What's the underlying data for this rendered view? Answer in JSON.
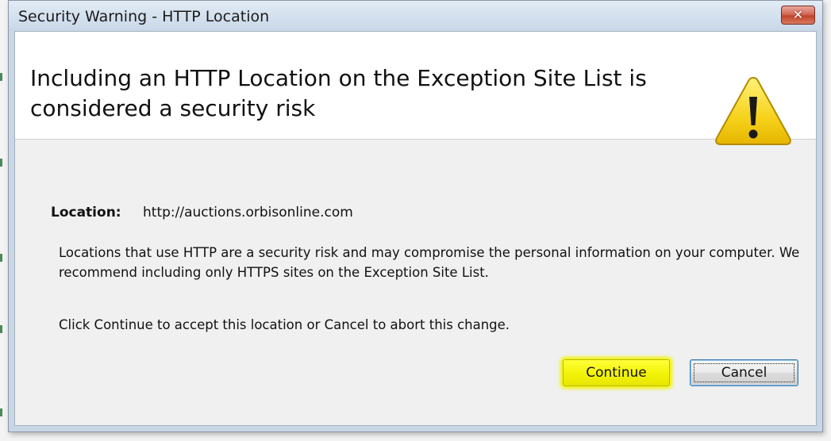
{
  "dialog": {
    "title": "Security Warning - HTTP Location",
    "close_icon": "close-icon",
    "heading": "Including an HTTP Location on the Exception Site List is considered a security risk",
    "warning_icon": "warning-triangle-icon",
    "location_label": "Location:",
    "location_value": "http://auctions.orbisonline.com",
    "message1": "Locations that use HTTP are a security risk and may compromise the personal information on your computer.  We recommend including only HTTPS sites on the Exception Site List.",
    "message2": "Click Continue to accept this location or Cancel to abort this change.",
    "continue_label": "Continue",
    "cancel_label": "Cancel"
  },
  "colors": {
    "highlight": "#f3f300",
    "close_button": "#c2432c",
    "warning_yellow": "#f6d21b"
  }
}
